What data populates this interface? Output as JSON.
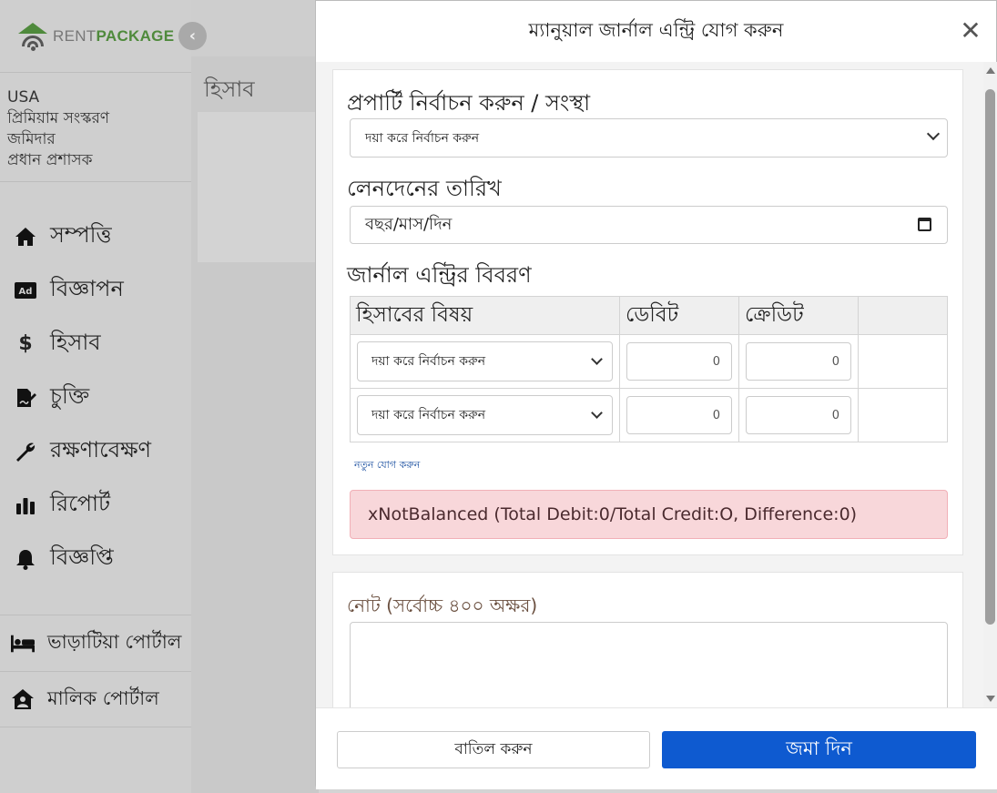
{
  "brand": {
    "name_light": "RENT",
    "name_bold": "PACKAGE",
    "color": "#4f8a3c"
  },
  "user": {
    "lines": [
      "USA",
      "প্রিমিয়াম সংস্করণ",
      "জমিদার",
      "প্রধান প্রশাসক"
    ]
  },
  "sidebar": {
    "items": [
      {
        "label": "সম্পত্তি",
        "icon": "home-icon"
      },
      {
        "label": "বিজ্ঞাপন",
        "icon": "ad-icon"
      },
      {
        "label": "হিসাব",
        "icon": "dollar-icon"
      },
      {
        "label": "চুক্তি",
        "icon": "contract-icon"
      },
      {
        "label": "রক্ষণাবেক্ষণ",
        "icon": "wrench-icon"
      },
      {
        "label": "রিপোর্ট",
        "icon": "bar-chart-icon"
      },
      {
        "label": "বিজ্ঞপ্তি",
        "icon": "bell-icon"
      }
    ],
    "bottom": [
      {
        "label": "ভাড়াটিয়া পোর্টাল",
        "icon": "bed-icon"
      },
      {
        "label": "মালিক পোর্টাল",
        "icon": "house-user-icon"
      }
    ]
  },
  "background_page": {
    "title": "হিসাব"
  },
  "modal": {
    "title": "ম্যানুয়াল জার্নাল এন্ট্রি যোগ করুন",
    "property_label": "প্রপার্টি নির্বাচন করুন / সংস্থা",
    "property_select": "দয়া করে নির্বাচন করুন",
    "date_label": "লেনদেনের তারিখ",
    "date_placeholder": "বছর/মাস/দিন",
    "details_label": "জার্নাল এন্ট্রির বিবরণ",
    "columns": [
      "হিসাবের বিষয়",
      "ডেবিট",
      "ক্রেডিট",
      ""
    ],
    "rows": [
      {
        "account": "দয়া করে নির্বাচন করুন",
        "debit": "0",
        "credit": "0"
      },
      {
        "account": "দয়া করে নির্বাচন করুন",
        "debit": "0",
        "credit": "0"
      }
    ],
    "add_new": "নতুন যোগ করুন",
    "alert": "xNotBalanced (Total Debit:0/Total Credit:O, Difference:0)",
    "note_label": "নোট (সর্বোচ্চ ৪০০ অক্ষর)",
    "cancel_label": "বাতিল করুন",
    "submit_label": "জমা দিন",
    "accent_color": "#0e5ad0",
    "alert_color": "#f8d7da"
  }
}
